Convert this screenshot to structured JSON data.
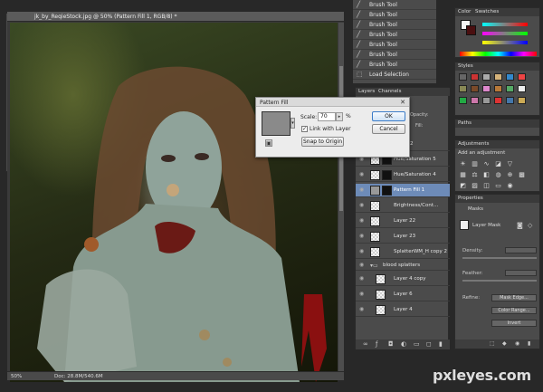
{
  "document": {
    "title": "jk_by_ReqieStock.jpg @ 50% (Pattern Fill 1, RGB/8) *",
    "zoom": "50%",
    "doc_size": "Doc: 28.8M/540.6M"
  },
  "history": {
    "items": [
      "Brush Tool",
      "Brush Tool",
      "Brush Tool",
      "Brush Tool",
      "Brush Tool",
      "Brush Tool",
      "Brush Tool",
      "Load Selection"
    ]
  },
  "layers_panel": {
    "tabs": [
      "Layers",
      "Channels"
    ],
    "opacity_label": "Opacity:",
    "fill_label": "Fill:",
    "layers": [
      {
        "name": "Curve 2",
        "active": false
      },
      {
        "name": "Hue/Saturation 5",
        "active": false
      },
      {
        "name": "Hue/Saturation 4",
        "active": false
      },
      {
        "name": "Pattern Fill 1",
        "active": true
      },
      {
        "name": "Brightness/Cont...",
        "active": false
      },
      {
        "name": "Layer 22",
        "active": false
      },
      {
        "name": "Layer 23",
        "active": false
      },
      {
        "name": "SplatterWM_H copy 2",
        "active": false
      },
      {
        "name": "blood splatters",
        "active": false
      },
      {
        "name": "Layer 4 copy",
        "active": false
      },
      {
        "name": "Layer 6",
        "active": false
      },
      {
        "name": "Layer 4",
        "active": false
      }
    ]
  },
  "color_panel": {
    "tabs": [
      "Color",
      "Swatches"
    ]
  },
  "styles_panel": {
    "title": "Styles"
  },
  "paths_panel": {
    "title": "Paths"
  },
  "adjustments_panel": {
    "title": "Adjustments",
    "subtitle": "Add an adjustment"
  },
  "properties_panel": {
    "title": "Properties",
    "section": "Masks",
    "mask_label": "Layer Mask",
    "density_label": "Density:",
    "feather_label": "Feather:",
    "refine_label": "Refine:",
    "mask_edge": "Mask Edge...",
    "color_range": "Color Range...",
    "invert": "Invert"
  },
  "dialog": {
    "title": "Pattern Fill",
    "scale_label": "Scale:",
    "scale_value": "70",
    "scale_unit": "%",
    "link_label": "Link with Layer",
    "snap_label": "Snap to Origin",
    "ok": "OK",
    "cancel": "Cancel"
  },
  "watermark": "pxleyes.com",
  "colors": {
    "accent": "#6d8bb8",
    "foreground": "#f5f5f5",
    "background": "#4a0f10"
  }
}
